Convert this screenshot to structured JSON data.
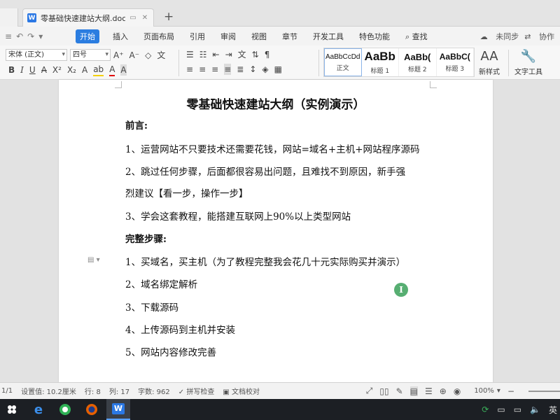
{
  "tab": {
    "title": "零基础快速建站大纲.docx",
    "icon": "W",
    "new_tab": "+"
  },
  "menu": {
    "items": [
      "开始",
      "插入",
      "页面布局",
      "引用",
      "审阅",
      "视图",
      "章节",
      "开发工具",
      "特色功能"
    ],
    "active_index": 0,
    "search": "查找",
    "sync_status": "未同步",
    "collaborate": "协作"
  },
  "ribbon": {
    "font_name": "宋体 (正文)",
    "font_size": "四号",
    "styles": [
      {
        "sample": "AaBbCcDd",
        "name": "正文"
      },
      {
        "sample": "AaBb",
        "name": "标题 1"
      },
      {
        "sample": "AaBb(",
        "name": "标题 2"
      },
      {
        "sample": "AaBbC(",
        "name": "标题 3"
      }
    ],
    "new_style": "新样式",
    "text_tool": "文字工具"
  },
  "document": {
    "title": "零基础快速建站大纲（实例演示）",
    "paragraphs": [
      {
        "text": "前言:",
        "bold": true
      },
      {
        "text": "1、运营网站不只要技术还需要花钱，网站=域名+主机+网站程序源码",
        "bold": false
      },
      {
        "text": "2、跳过任何步骤，后面都很容易出问题，且难找不到原因，新手强",
        "bold": false
      },
      {
        "text": "烈建议【看一步，操作一步】",
        "bold": false
      },
      {
        "text": "3、学会这套教程，能搭建互联网上90%以上类型网站",
        "bold": false
      },
      {
        "text": "完整步骤:",
        "bold": true
      },
      {
        "text": "1、买域名，买主机（为了教程完整我会花几十元实际购买并演示）",
        "bold": false
      },
      {
        "text": "2、域名绑定解析",
        "bold": false
      },
      {
        "text": "3、下载源码",
        "bold": false
      },
      {
        "text": "4、上传源码到主机并安装",
        "bold": false
      },
      {
        "text": "5、网站内容修改完善",
        "bold": false
      }
    ]
  },
  "statusbar": {
    "page": "1/1",
    "position": "设置值: 10.2厘米",
    "row": "行: 8",
    "col": "列: 17",
    "word_count": "字数: 962",
    "spell_check": "拼写检查",
    "doc_proof": "文档校对",
    "zoom": "100%"
  },
  "taskbar": {
    "ime": "英"
  },
  "colors": {
    "accent": "#2b7de0",
    "cursor": "#3aa15a"
  }
}
